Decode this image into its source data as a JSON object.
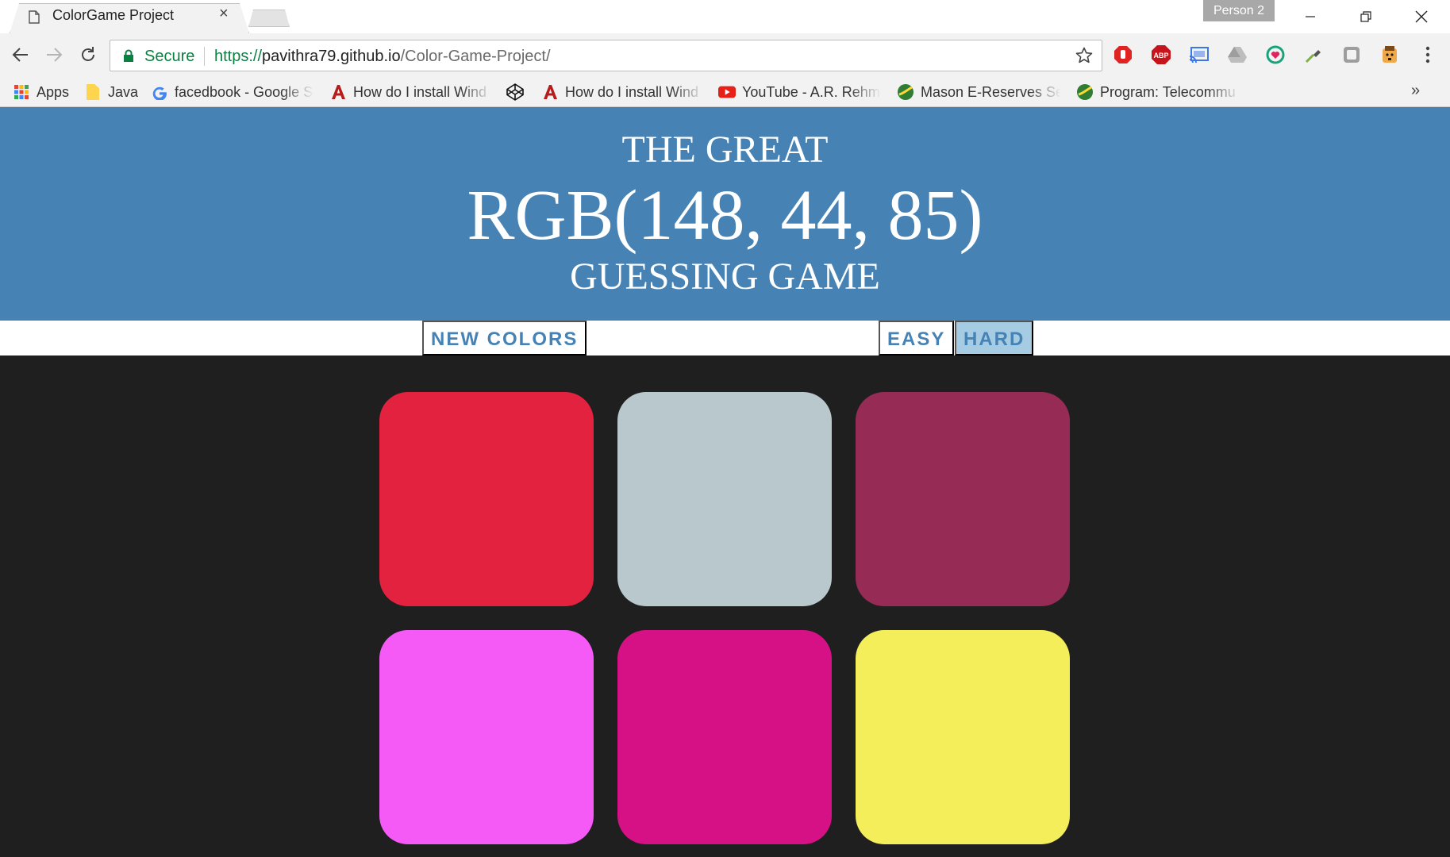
{
  "browser": {
    "tab": {
      "title": "ColorGame Project",
      "close": "×"
    },
    "profile": "Person 2",
    "omnibox": {
      "secure_label": "Secure",
      "url_scheme": "https://",
      "url_host": "pavithra79.github.io",
      "url_path": "/Color-Game-Project/"
    },
    "extensions": [
      "stop-icon",
      "abp-icon",
      "cast-icon",
      "drive-icon",
      "heart-icon",
      "eyedropper-icon",
      "blank-extension-icon",
      "character-icon"
    ],
    "bookmarks": [
      {
        "label": "Apps",
        "icon": "apps-grid-icon"
      },
      {
        "label": "Java",
        "icon": "folder-icon"
      },
      {
        "label": "facedbook - Google S",
        "icon": "google-icon"
      },
      {
        "label": "How do I install Wind",
        "icon": "a-icon"
      },
      {
        "label": "",
        "icon": "codepen-icon"
      },
      {
        "label": "How do I install Wind",
        "icon": "a-icon"
      },
      {
        "label": "YouTube - A.R. Rehma",
        "icon": "youtube-icon"
      },
      {
        "label": "Mason E-Reserves Sea",
        "icon": "mason-icon"
      },
      {
        "label": "Program: Telecommu",
        "icon": "mason-icon"
      }
    ],
    "overflow": "»"
  },
  "game": {
    "header": {
      "line1": "THE GREAT",
      "rgb": "RGB(148, 44, 85)",
      "line3": "GUESSING GAME",
      "background": "#4682b4"
    },
    "controls": {
      "new_colors": "NEW COLORS",
      "easy": "EASY",
      "hard": "HARD",
      "selected_mode": "hard",
      "accent": "#4682b4",
      "selected_bg": "#a6cce4"
    },
    "squares": [
      "#e3223f",
      "#b9c8cc",
      "#962b55",
      "#f55af6",
      "#d61185",
      "#f4ee5a"
    ],
    "page_background": "#1f1f1f"
  }
}
